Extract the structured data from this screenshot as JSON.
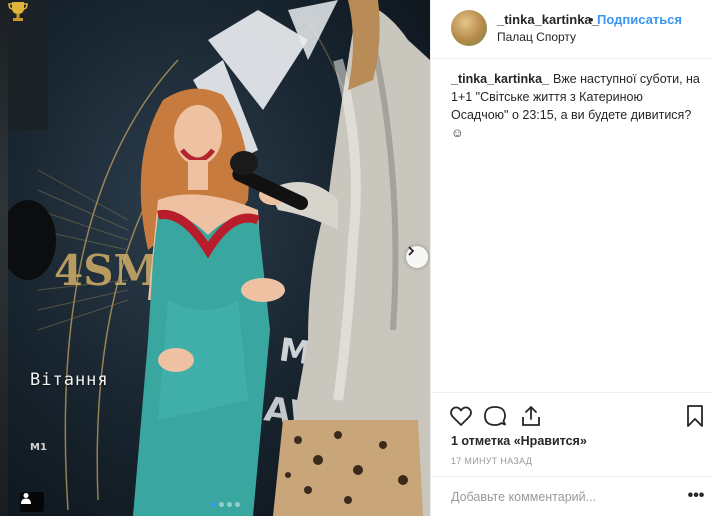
{
  "post": {
    "username": "_tinka_kartinka_",
    "separator": "•",
    "follow_label": "Подписаться",
    "location": "Палац Спорту",
    "caption_text": "Вже наступної суботи, на 1+1 \"Світське життя з Катериною Осадчою\" о 23:15, а ви будете дивитися?☺",
    "likes_text": "1 отметка «Нравится»",
    "time_text": "17 МИНУТ НАЗАД",
    "comment_placeholder": "Добавьте комментарий...",
    "more_label": "•••"
  },
  "photo": {
    "overlay_text": "Вітання",
    "backdrop_text": "4SM",
    "backdrop_text_2": "MUSIC",
    "backdrop_text_3": "AWARDS",
    "carousel": {
      "total": 4,
      "active": 0
    }
  },
  "icons": {
    "like": "heart-icon",
    "comment": "comment-bubble-icon",
    "share": "share-upload-icon",
    "save": "bookmark-icon",
    "next": "chevron-right-icon",
    "tag": "user-tag-icon",
    "trophy": "trophy-icon"
  },
  "colors": {
    "accent": "#3897f0",
    "text": "#262626",
    "muted": "#999999",
    "divider": "#efefef",
    "dress": "#3aa6a0",
    "jacket": "#c9c6bd"
  }
}
